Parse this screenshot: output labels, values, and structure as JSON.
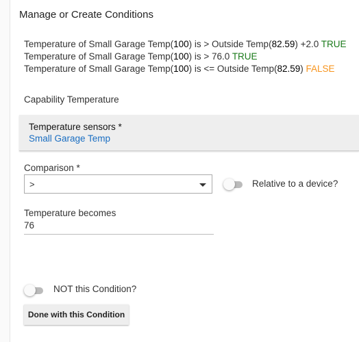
{
  "title": "Manage or Create Conditions",
  "conditions": [
    {
      "pre": "Temperature of Small Garage Temp(",
      "val": "100",
      "mid": ") is > Outside Temp(",
      "val2": "82.59",
      "post": ") +2.0 ",
      "result": "TRUE"
    },
    {
      "pre": "Temperature of Small Garage Temp(",
      "val": "100",
      "mid": ") is > 76.0 ",
      "result": "TRUE"
    },
    {
      "pre": "Temperature of Small Garage Temp(",
      "val": "100",
      "mid": ") is <= Outside Temp(",
      "val2": "82.59",
      "post": ") ",
      "result": "FALSE"
    }
  ],
  "capability": "Capability Temperature",
  "sensors": {
    "label": "Temperature sensors *",
    "value": "Small Garage Temp"
  },
  "comparison": {
    "label": "Comparison *",
    "value": ">"
  },
  "relative": {
    "label": "Relative to a device?",
    "on": false
  },
  "temperature": {
    "label": "Temperature becomes",
    "value": "76"
  },
  "not_condition": {
    "label": "NOT this Condition?",
    "on": false
  },
  "done_button": "Done with this Condition",
  "colors": {
    "true": "#1a7a1a",
    "false": "#f7941d",
    "link": "#1a6ec2"
  }
}
